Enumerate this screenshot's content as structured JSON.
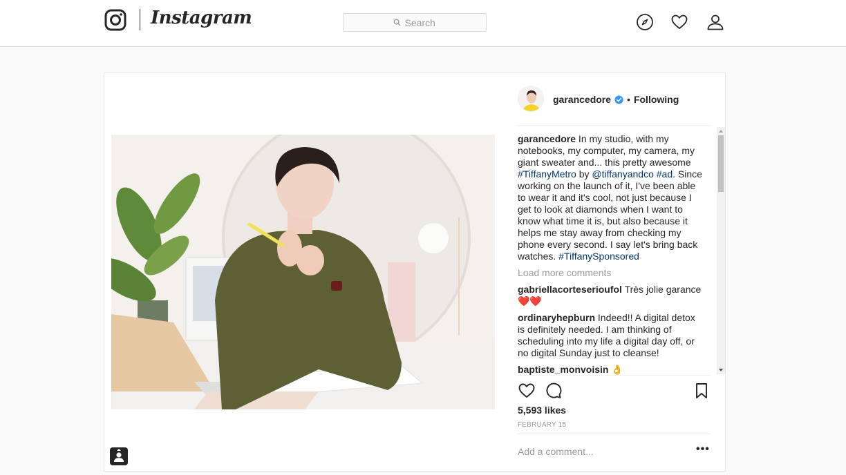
{
  "nav": {
    "wordmark": "Instagram",
    "search_placeholder": "Search",
    "icons": [
      "instagram-glyph-icon",
      "search-icon",
      "compass-icon",
      "heart-icon",
      "profile-icon"
    ]
  },
  "post": {
    "author": {
      "username": "garancedore",
      "verified": true,
      "separator": "•",
      "follow_status": "Following"
    },
    "caption": {
      "username": "garancedore",
      "text_1": " In my studio, with my notebooks, my computer, my camera, my giant sweater and... this pretty awesome ",
      "hashtag_1": "#TiffanyMetro",
      "text_2": " by ",
      "mention": "@tiffanyandco",
      "text_3": " ",
      "hashtag_2": "#ad",
      "text_4": ". Since working on the launch of it, I've been able to wear it and it's cool, not just because I get to look at diamonds when I want to know what time it is, but also because it helps me stay away from checking my phone every second. I say let's bring back watches. ",
      "hashtag_3": "#TiffanySponsored"
    },
    "load_more": "Load more comments",
    "comments": [
      {
        "username": "gabriellacorteserioufol",
        "text": " Très jolie garance",
        "emoji": "❤️❤️"
      },
      {
        "username": "ordinaryhepburn",
        "text": " Indeed!! A digital detox is definitely needed. I am thinking of scheduling into my life a digital day off, or no digital Sunday just to cleanse!"
      },
      {
        "username": "baptiste_monvoisin",
        "text": " ",
        "emoji": "👌"
      }
    ],
    "likes": "5,593 likes",
    "date": "FEBRUARY 15",
    "comment_placeholder": "Add a comment...",
    "more_options": "•••"
  },
  "colors": {
    "link": "#003569",
    "verified": "#3897f0",
    "heart": "#ed4956",
    "muted": "#999999",
    "border": "#dbdbdb"
  }
}
